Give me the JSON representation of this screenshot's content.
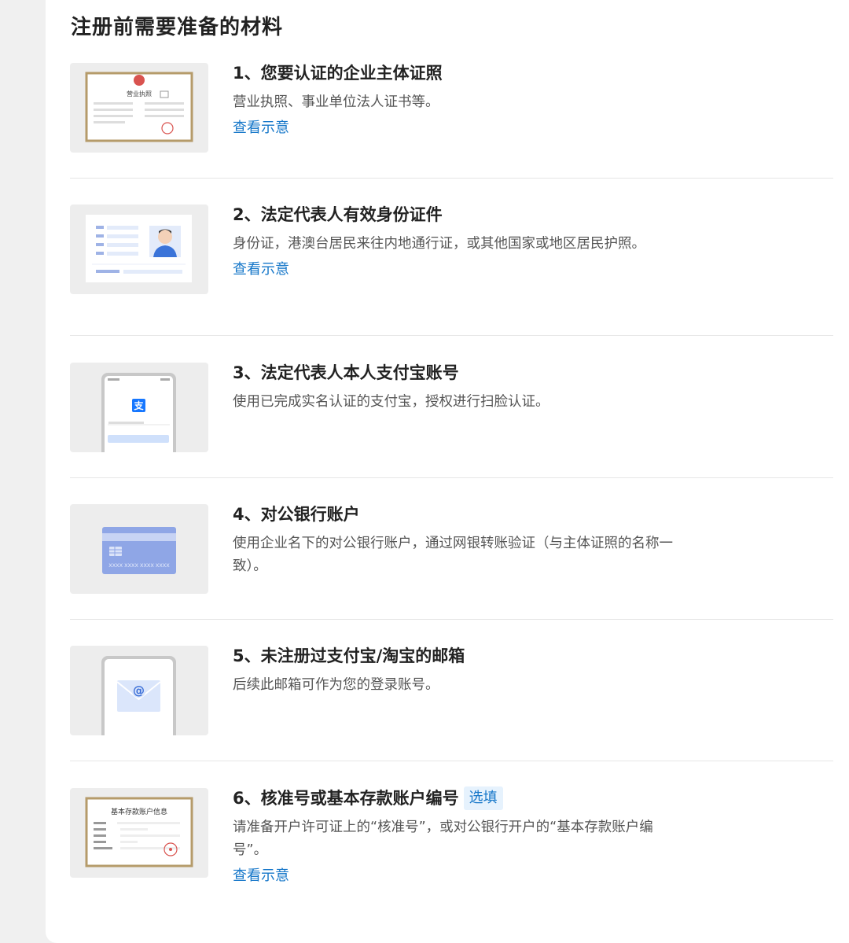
{
  "page": {
    "title": "注册前需要准备的材料"
  },
  "items": [
    {
      "title": "1、您要认证的企业主体证照",
      "desc": "营业执照、事业单位法人证书等。",
      "link": "查看示意",
      "thumb_icon": "business-license-icon",
      "thumb_text": "营业执照"
    },
    {
      "title": "2、法定代表人有效身份证件",
      "desc": "身份证，港澳台居民来往内地通行证，或其他国家或地区居民护照。",
      "link": "查看示意",
      "thumb_icon": "id-card-icon"
    },
    {
      "title": "3、法定代表人本人支付宝账号",
      "desc": "使用已完成实名认证的支付宝，授权进行扫脸认证。",
      "thumb_icon": "alipay-phone-icon",
      "thumb_text": "支"
    },
    {
      "title": "4、对公银行账户",
      "desc": "使用企业名下的对公银行账户，通过网银转账验证（与主体证照的名称一致）。",
      "thumb_icon": "bank-card-icon",
      "thumb_text": "XXXX  XXXX  XXXX  XXXX"
    },
    {
      "title": "5、未注册过支付宝/淘宝的邮箱",
      "desc": "后续此邮箱可作为您的登录账号。",
      "thumb_icon": "email-phone-icon",
      "thumb_text": "@"
    },
    {
      "title": "6、核准号或基本存款账户编号",
      "badge": "选填",
      "desc": "请准备开户许可证上的“核准号”，或对公银行开户的“基本存款账户编号”。",
      "link": "查看示意",
      "thumb_icon": "account-certificate-icon",
      "thumb_text": "基本存款账户信息"
    }
  ],
  "colors": {
    "link": "#1677c9",
    "badge_bg": "#e6f2fd",
    "card_blue": "#8fa6e6",
    "frame_gold": "#b59b6a",
    "stamp_red": "#d9534f"
  }
}
